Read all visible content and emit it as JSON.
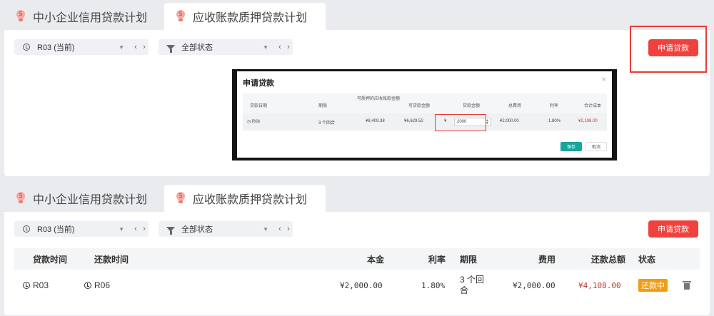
{
  "tabs": [
    {
      "label": "中小企业信用贷款计划",
      "icon": "bulb-icon",
      "badge": "5"
    },
    {
      "label": "应收账款质押贷款计划",
      "icon": "bulb-icon",
      "badge": "5"
    }
  ],
  "toolbar": {
    "round_select": "R03 (当前)",
    "status_select": "全部状态",
    "apply_button": "申请贷款"
  },
  "dialog": {
    "title": "申请贷款",
    "close": "×",
    "columns": [
      "贷款日期",
      "期限",
      "可质押的应收账款金额",
      "可贷款金额",
      "贷款金额",
      "总费用",
      "利率",
      "合计成本"
    ],
    "row": {
      "date": "R06",
      "term": "3 个回合",
      "pledgeable": "¥8,409.38",
      "available": "¥6,629.52",
      "currency": "¥",
      "amount_input": "2000",
      "total_fee": "¥2,000.00",
      "rate": "1.80%",
      "total_cost": "¥2,108.00"
    },
    "ok_button": "保存",
    "cancel_button": "取消"
  },
  "table": {
    "columns": [
      "贷款时间",
      "还款时间",
      "本金",
      "利率",
      "期限",
      "费用",
      "还款总额",
      "状态"
    ],
    "rows": [
      {
        "loan_time": "R03",
        "repay_time": "R06",
        "principal": "¥2,000.00",
        "rate": "1.80%",
        "term": "3 个回合",
        "fee": "¥2,000.00",
        "total": "¥4,108.00",
        "status": "还款中"
      }
    ]
  },
  "colors": {
    "accent": "#f0413c",
    "teal": "#1aa59c",
    "status_orange": "#f39c12",
    "amount_red": "#c0392b"
  }
}
